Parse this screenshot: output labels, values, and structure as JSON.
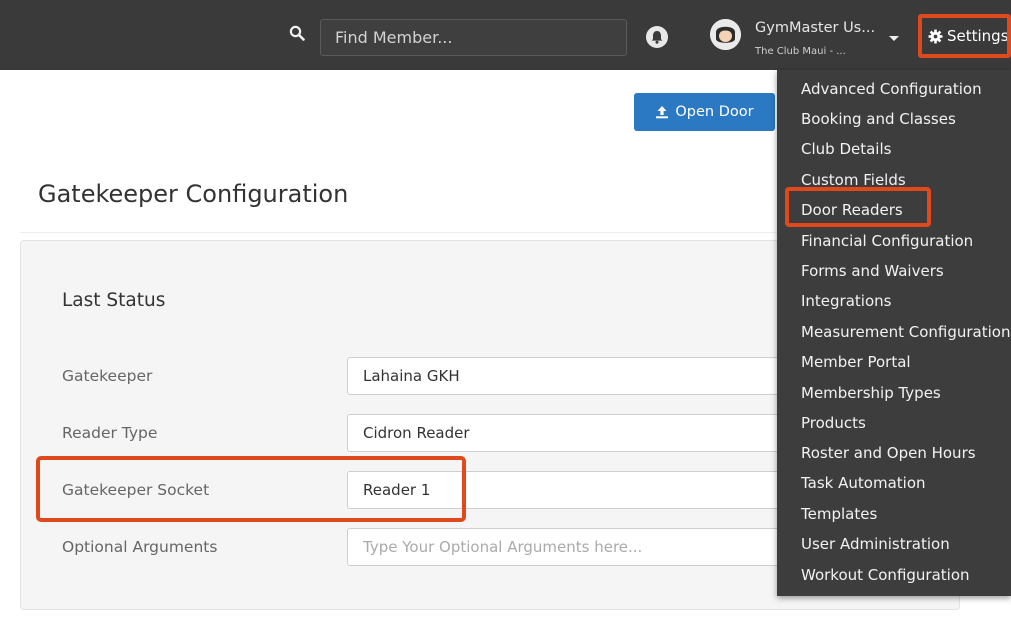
{
  "header": {
    "search_placeholder": "Find Member...",
    "user_name": "GymMaster Us...",
    "user_club": "The Club Maui - ...",
    "settings_label": "Settings",
    "icons": [
      "search-icon",
      "bell-icon",
      "avatar",
      "chevron-down-icon",
      "gear-icon"
    ]
  },
  "toolbar": {
    "open_door_label": "Open Door",
    "open_door_icon": "upload-icon"
  },
  "page": {
    "title": "Gatekeeper Configuration"
  },
  "last_status": {
    "title": "Last Status",
    "fields": [
      {
        "label": "Gatekeeper",
        "value": "Lahaina GKH"
      },
      {
        "label": "Reader Type",
        "value": "Cidron Reader"
      },
      {
        "label": "Gatekeeper Socket",
        "value": "Reader 1"
      },
      {
        "label": "Optional Arguments",
        "placeholder": "Type Your Optional Arguments here..."
      }
    ]
  },
  "settings_menu": {
    "items": [
      "Advanced Configuration",
      "Booking and Classes",
      "Club Details",
      "Custom Fields",
      "Door Readers",
      "Financial Configuration",
      "Forms and Waivers",
      "Integrations",
      "Measurement Configuration",
      "Member Portal",
      "Membership Types",
      "Products",
      "Roster and Open Hours",
      "Task Automation",
      "Templates",
      "User Administration",
      "Workout Configuration"
    ]
  },
  "colors": {
    "topbar": "#3a3a3a",
    "menu": "#3d3d3d",
    "primary": "#2b78c3",
    "highlight": "#e0491d"
  }
}
